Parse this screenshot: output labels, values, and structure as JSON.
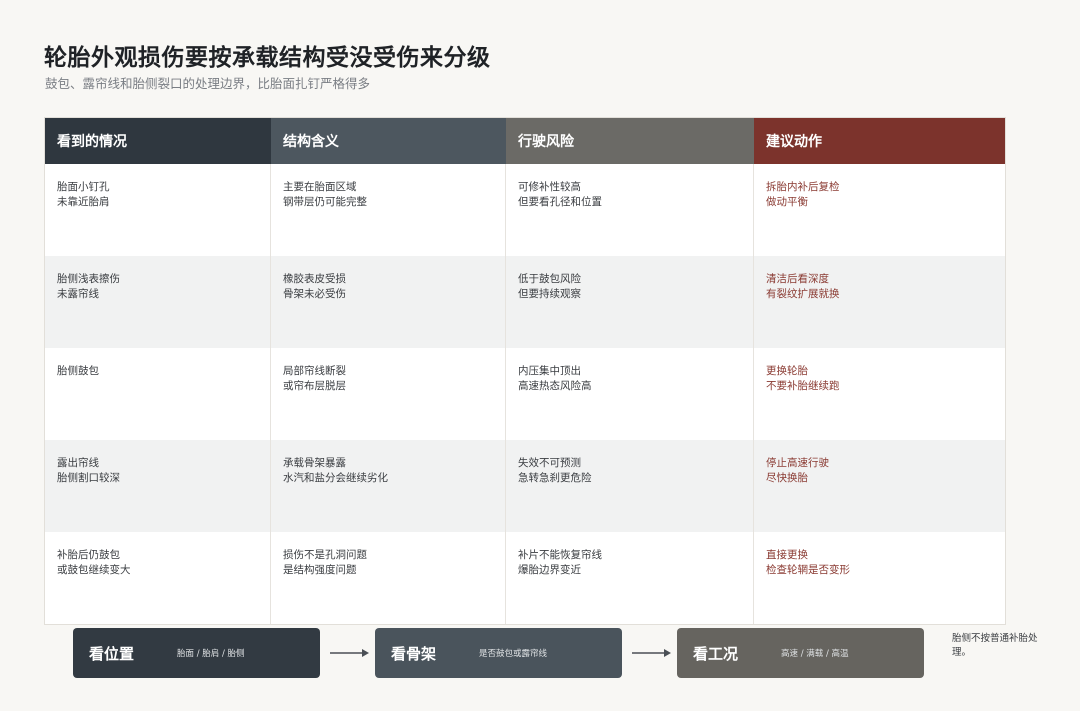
{
  "title": "轮胎外观损伤要按承载结构受没受伤来分级",
  "subtitle": "鼓包、露帘线和胎侧裂口的处理边界，比胎面扎钉严格得多",
  "table": {
    "headers": [
      "看到的情况",
      "结构含义",
      "行驶风险",
      "建议动作"
    ],
    "rows": [
      [
        "胎面小钉孔\n未靠近胎肩",
        "主要在胎面区域\n钢带层仍可能完整",
        "可修补性较高\n但要看孔径和位置",
        "拆胎内补后复检\n做动平衡"
      ],
      [
        "胎侧浅表擦伤\n未露帘线",
        "橡胶表皮受损\n骨架未必受伤",
        "低于鼓包风险\n但要持续观察",
        "清洁后看深度\n有裂纹扩展就换"
      ],
      [
        "胎侧鼓包",
        "局部帘线断裂\n或帘布层脱层",
        "内压集中顶出\n高速热态风险高",
        "更换轮胎\n不要补胎继续跑"
      ],
      [
        "露出帘线\n胎侧割口较深",
        "承载骨架暴露\n水汽和盐分会继续劣化",
        "失效不可预测\n急转急刹更危险",
        "停止高速行驶\n尽快换胎"
      ],
      [
        "补胎后仍鼓包\n或鼓包继续变大",
        "损伤不是孔洞问题\n是结构强度问题",
        "补片不能恢复帘线\n爆胎边界变近",
        "直接更换\n检查轮辋是否变形"
      ]
    ]
  },
  "flow": [
    {
      "label": "看位置",
      "sub": "胎面 / 胎肩 / 胎侧"
    },
    {
      "label": "看骨架",
      "sub": "是否鼓包或露帘线"
    },
    {
      "label": "看工况",
      "sub": "高速 / 满载 / 高温"
    }
  ],
  "note": "胎侧不按普通补胎处理。",
  "colors": {
    "header_1": "#2f373f",
    "header_2": "#4d575f",
    "header_3": "#6b6a66",
    "header_4": "#7c332c",
    "action_text": "#8a3a32",
    "background": "#f8f7f4"
  }
}
